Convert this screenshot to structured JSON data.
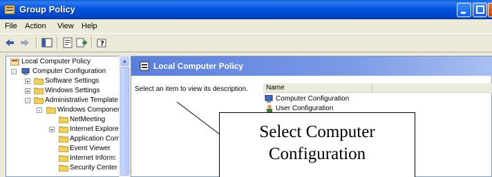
{
  "window": {
    "title": "Group Policy",
    "icon": "group-policy-icon",
    "controls": [
      "minimize-icon",
      "maximize-icon",
      "close-icon"
    ]
  },
  "menu": {
    "items": [
      "File",
      "Action",
      "View",
      "Help"
    ]
  },
  "toolbar": {
    "buttons": [
      "back-arrow-icon",
      "forward-arrow-icon",
      "show-hide-tree-icon",
      "properties-icon",
      "export-list-icon",
      "help-icon"
    ]
  },
  "tree": {
    "items": [
      {
        "label": "Local Computer Policy",
        "level": 0,
        "expander": "",
        "icon": "policy-icon"
      },
      {
        "label": "Computer Configuration",
        "level": 1,
        "expander": "-",
        "icon": "computer-icon"
      },
      {
        "label": "Software Settings",
        "level": 2,
        "expander": "+",
        "icon": "folder-icon"
      },
      {
        "label": "Windows Settings",
        "level": 2,
        "expander": "+",
        "icon": "folder-icon"
      },
      {
        "label": "Administrative Template",
        "level": 2,
        "expander": "-",
        "icon": "folder-icon"
      },
      {
        "label": "Windows Componer",
        "level": 3,
        "expander": "-",
        "icon": "folder-icon"
      },
      {
        "label": "NetMeeting",
        "level": 4,
        "expander": "",
        "icon": "folder-icon"
      },
      {
        "label": "Internet Explore",
        "level": 4,
        "expander": "+",
        "icon": "folder-icon"
      },
      {
        "label": "Application Com",
        "level": 4,
        "expander": "",
        "icon": "folder-icon"
      },
      {
        "label": "Event Viewer",
        "level": 4,
        "expander": "",
        "icon": "folder-icon"
      },
      {
        "label": "Internet Inform:",
        "level": 4,
        "expander": "",
        "icon": "folder-icon"
      },
      {
        "label": "Security Center",
        "level": 4,
        "expander": "",
        "icon": "folder-icon"
      }
    ]
  },
  "details": {
    "header_title": "Local Computer Policy",
    "description": "Select an item to view its description.",
    "column_name": "Name",
    "rows": [
      {
        "label": "Computer Configuration",
        "icon": "computer-icon"
      },
      {
        "label": "User Configuration",
        "icon": "user-icon"
      }
    ]
  },
  "callout": {
    "line1": "Select Computer",
    "line2": "Configuration"
  },
  "colors": {
    "titlebar": "#0053e0",
    "chrome": "#ece9d8",
    "banner": "#5a7edc"
  }
}
